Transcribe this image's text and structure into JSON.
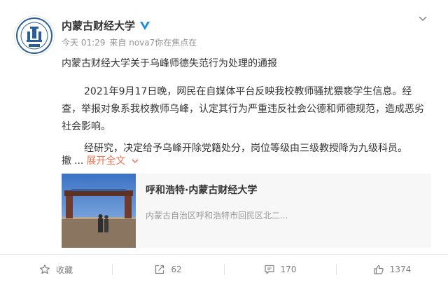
{
  "post": {
    "author": "内蒙古财经大学",
    "time": "今天 01:29",
    "source": "来自 nova7你在焦点在",
    "title": "内蒙古财经大学关于乌峰师德失范行为处理的通报",
    "paragraphs": [
      "2021年9月17日晚，网民在自媒体平台反映我校教师骚扰猥亵学生信息。经查，举报对象系我校教师乌峰，认定其行为严重违反社会公德和师德规范，造成恶劣社会影响。",
      "经研究，决定给予乌峰开除党籍处分，岗位等级由三级教授降为九级科员。"
    ],
    "truncated_text": "撤",
    "ellipsis": "...",
    "expand_label": "展开全文"
  },
  "location": {
    "name": "呼和浩特·内蒙古财经大学",
    "address": "内蒙古自治区呼和浩特市回民区北二..."
  },
  "actions": {
    "favorite_label": "收藏",
    "repost_count": "62",
    "comment_count": "170",
    "like_count": "1374"
  },
  "colors": {
    "accent": "#eb7350",
    "verified": "#1f8ddc",
    "logo_blue": "#2a5d9c"
  }
}
